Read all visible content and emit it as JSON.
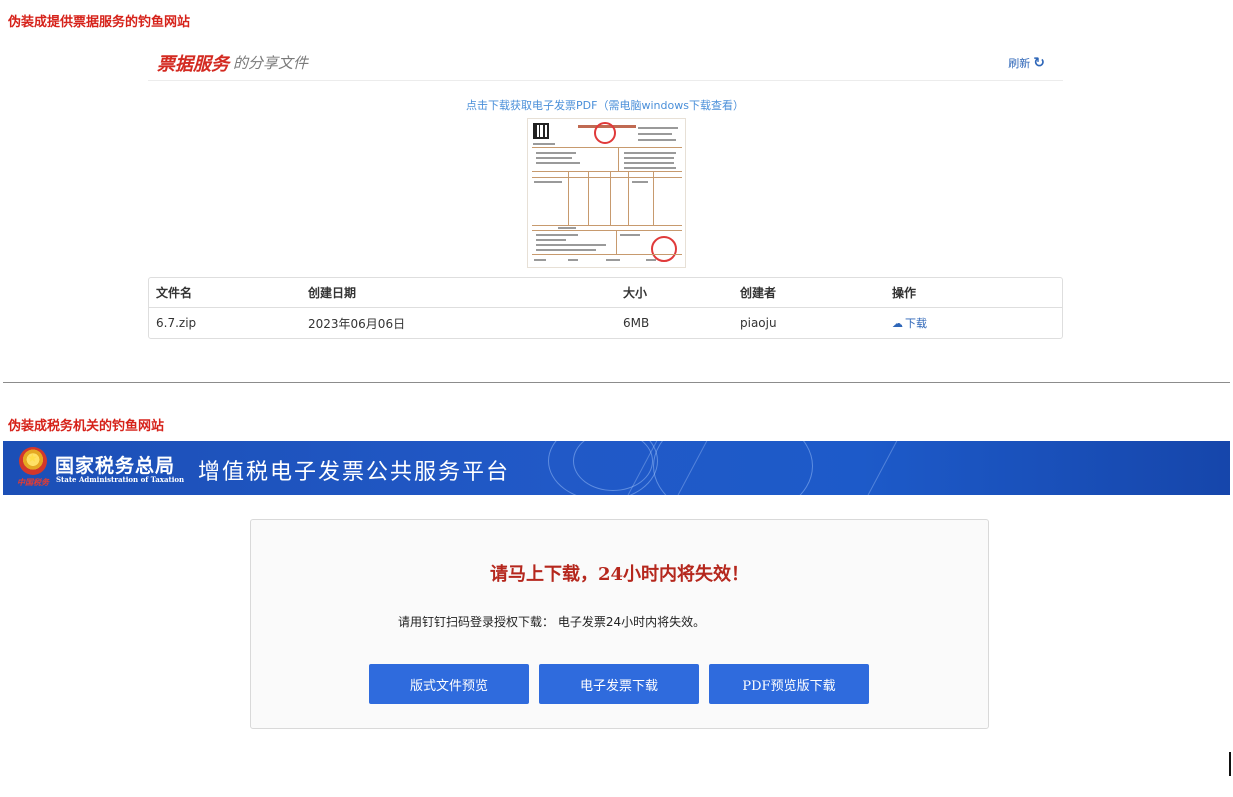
{
  "section1": {
    "caption": "伪装成提供票据服务的钓鱼网站",
    "brand": "票据服务",
    "brand_sub": "的分享文件",
    "refresh_label": "刷新",
    "download_link": "点击下载获取电子发票PDF（需电脑windows下载查看）",
    "table": {
      "headers": [
        "文件名",
        "创建日期",
        "大小",
        "创建者",
        "操作"
      ],
      "row": {
        "file_name": "6.7.zip",
        "created": "2023年06月06日",
        "size": "6MB",
        "creator": "piaoju",
        "action": "下载"
      }
    }
  },
  "section2": {
    "caption": "伪装成税务机关的钓鱼网站",
    "agency_cn": "国家税务总局",
    "agency_en": "State Administration of Taxation",
    "platform_title": "增值税电子发票公共服务平台",
    "warning": "请马上下载，24小时内将失效！",
    "instruction": "请用钉钉扫码登录授权下载： 电子发票24小时内将失效。",
    "buttons": {
      "preview_format": "版式文件预览",
      "invoice_download": "电子发票下载",
      "pdf_download": "PDF预览版下载"
    }
  },
  "colors": {
    "caption_red": "#d6221a",
    "brand_red": "#d32a21",
    "link_blue": "#4a8fd9",
    "banner_blue": "#1c4fb6",
    "button_blue": "#2f6bdd",
    "warning_red": "#b5271d"
  },
  "icons": {
    "refresh": "refresh-icon",
    "download": "cloud-download-icon",
    "emblem": "national-emblem-icon"
  }
}
